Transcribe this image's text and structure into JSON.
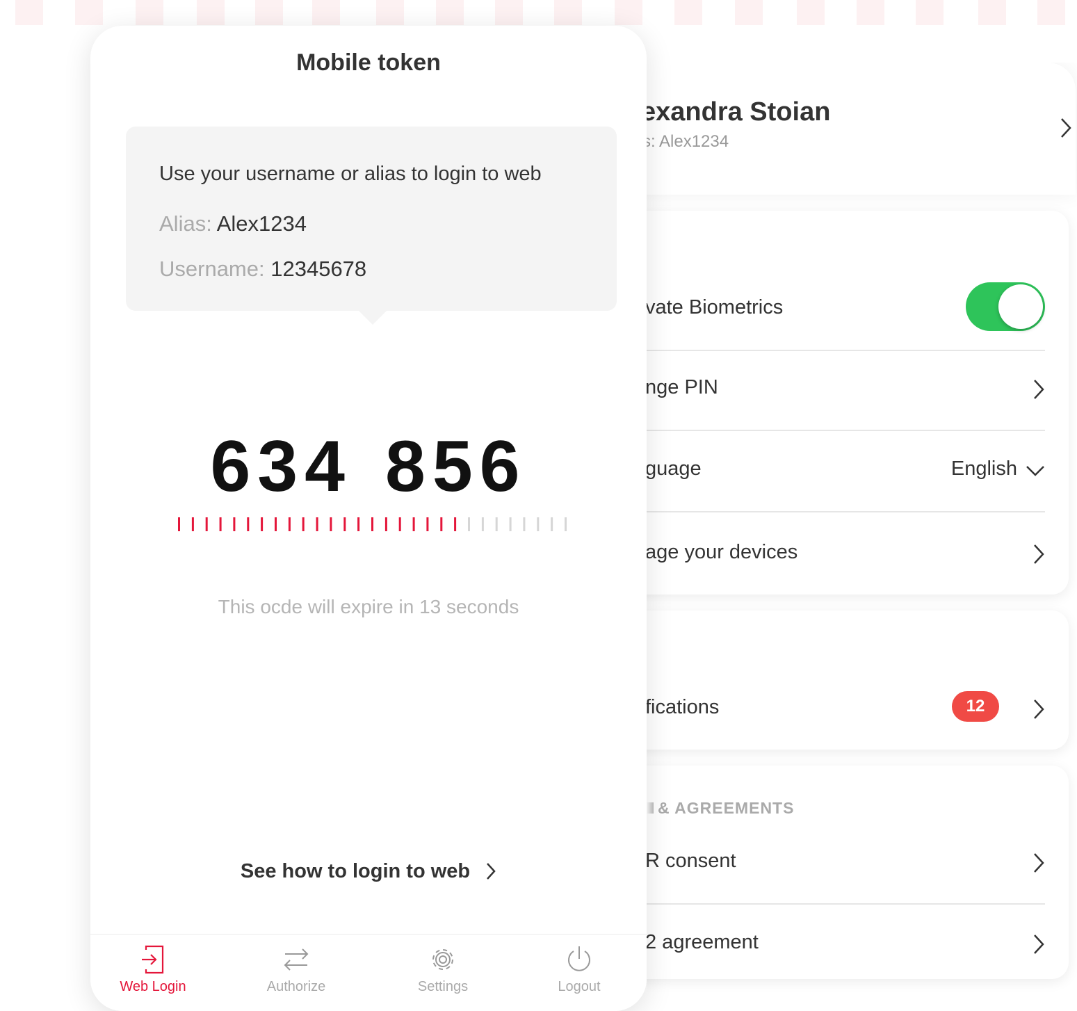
{
  "colors": {
    "accent": "#e4163a",
    "toggle_on": "#2ec45a",
    "badge": "#f04a45",
    "timer_inactive": "#d6d6d6"
  },
  "settings": {
    "profile": {
      "name": "exandra Stoian",
      "alias": "s: Alex1234"
    },
    "security": {
      "rows": [
        {
          "label": "vate Biometrics",
          "control": "toggle",
          "toggle_on": true
        },
        {
          "label": "nge PIN",
          "control": "chevron-right-icon"
        },
        {
          "label": "guage",
          "value": "English",
          "control": "chevron-down-icon"
        },
        {
          "label": "age your devices",
          "control": "chevron-right-icon"
        }
      ]
    },
    "notifications": {
      "label": "fications",
      "badge": "12"
    },
    "agreements": {
      "header": "& AGREEMENTS",
      "rows": [
        {
          "label": "R consent"
        },
        {
          "label": "2 agreement"
        }
      ]
    }
  },
  "token": {
    "title": "Mobile token",
    "info": {
      "heading": "Use your username or alias to login to web",
      "alias_label": "Alias:",
      "alias_value": "Alex1234",
      "username_label": "Username:",
      "username_value": "12345678"
    },
    "code_part1": "634",
    "code_part2": "856",
    "timer": {
      "total_ticks": 29,
      "remaining_ticks": 21
    },
    "expire_text": "This ocde will expire in 13 seconds",
    "help_link": "See how to login to web"
  },
  "tabs": [
    {
      "label": "Web Login",
      "icon": "login-icon",
      "active": true
    },
    {
      "label": "Authorize",
      "icon": "arrows-swap-icon",
      "active": false
    },
    {
      "label": "Settings",
      "icon": "gear-icon",
      "active": false
    },
    {
      "label": "Logout",
      "icon": "power-icon",
      "active": false
    }
  ]
}
